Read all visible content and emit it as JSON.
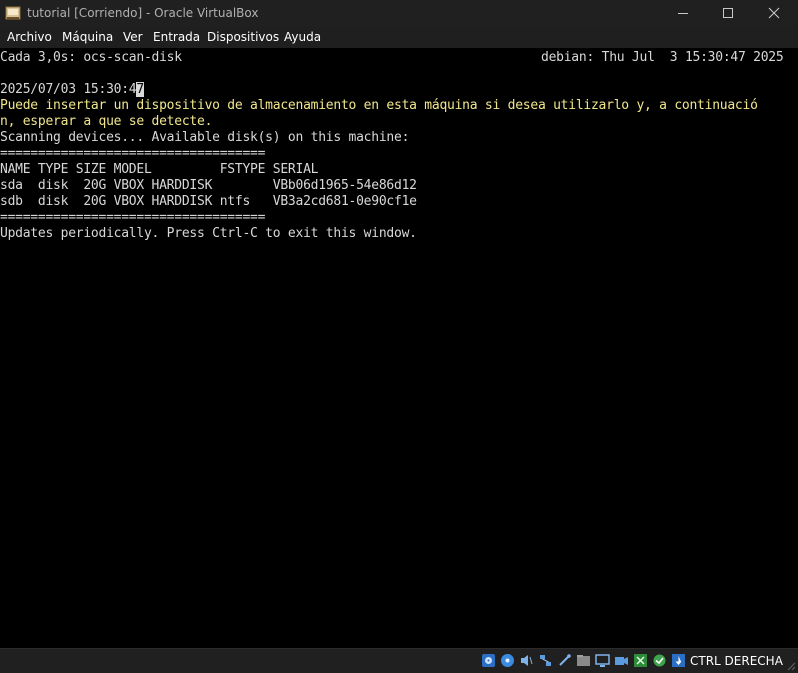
{
  "window": {
    "title": "tutorial [Corriendo] - Oracle VirtualBox"
  },
  "menu": {
    "items": [
      "Archivo",
      "Máquina",
      "Ver",
      "Entrada",
      "Dispositivos",
      "Ayuda"
    ]
  },
  "terminal": {
    "header_left": "Cada 3,0s: ocs-scan-disk",
    "header_right": "debian: Thu Jul  3 15:30:47 2025",
    "timestamp_before_cursor": "2025/07/03 15:30:4",
    "cursor_char": "7",
    "yellow_line_1": "Puede insertar un dispositivo de almacenamiento en esta máquina si desea utilizarlo y, a continuació",
    "yellow_line_2": "n, esperar a que se detecte.",
    "scanning_line": "Scanning devices... Available disk(s) on this machine:",
    "separator": "===================================",
    "table_header": "NAME TYPE SIZE MODEL         FSTYPE SERIAL",
    "rows": [
      "sda  disk  20G VBOX HARDDISK        VBb06d1965-54e86d12",
      "sdb  disk  20G VBOX HARDDISK ntfs   VB3a2cd681-0e90cf1e"
    ],
    "footer_line": "Updates periodically. Press Ctrl-C to exit this window."
  },
  "colors": {
    "terminal_text": "#d8d8d8",
    "terminal_yellow": "#f0e68c",
    "titlebar_bg": "#202020"
  },
  "statusbar": {
    "icons": [
      "hard-disk-icon",
      "optical-drive-icon",
      "audio-icon",
      "network-icon",
      "usb-icon",
      "shared-folders-icon",
      "display-icon",
      "video-capture-icon",
      "recording-icon",
      "cpu-icon",
      "mouse-integration-icon",
      "keyboard-icon"
    ],
    "host_key": "CTRL DERECHA"
  }
}
